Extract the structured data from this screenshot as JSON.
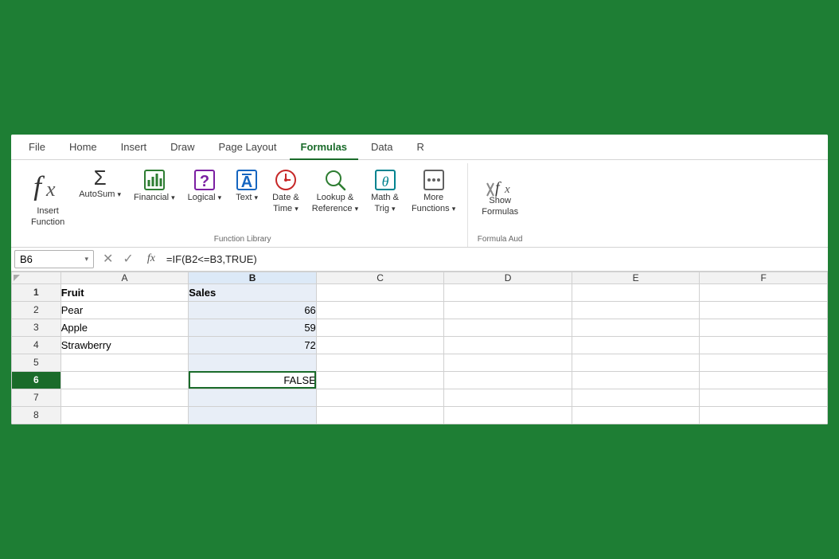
{
  "ribbon": {
    "tabs": [
      "File",
      "Home",
      "Insert",
      "Draw",
      "Page Layout",
      "Formulas",
      "Data",
      "R"
    ],
    "active_tab": "Formulas",
    "groups": [
      {
        "name": "function-library",
        "label": "Function Library",
        "buttons": [
          {
            "id": "insert-function",
            "icon": "fx",
            "label": "Insert\nFunction",
            "icon_type": "italic"
          },
          {
            "id": "autosum",
            "icon": "Σ",
            "label": "AutoSum",
            "has_chevron": true,
            "icon_type": "sigma"
          },
          {
            "id": "financial",
            "icon": "🏦",
            "label": "Financial",
            "has_chevron": true,
            "icon_type": "financial"
          },
          {
            "id": "logical",
            "icon": "?",
            "label": "Logical",
            "has_chevron": true,
            "icon_type": "logical"
          },
          {
            "id": "text",
            "icon": "A",
            "label": "Text",
            "has_chevron": true,
            "icon_type": "text"
          },
          {
            "id": "datetime",
            "icon": "⏰",
            "label": "Date &\nTime",
            "has_chevron": true,
            "icon_type": "datetime"
          },
          {
            "id": "lookup",
            "icon": "🔍",
            "label": "Lookup &\nReference",
            "has_chevron": true,
            "icon_type": "lookup"
          },
          {
            "id": "math",
            "icon": "θ",
            "label": "Math &\nTrig",
            "has_chevron": true,
            "icon_type": "math"
          },
          {
            "id": "more",
            "icon": "···",
            "label": "More\nFunctions",
            "has_chevron": true,
            "icon_type": "more"
          }
        ]
      },
      {
        "name": "formula-auditing",
        "label": "Formula Aud",
        "buttons": [
          {
            "id": "show-formulas",
            "icon": "fx",
            "label": "Show\nFormulas",
            "icon_type": "show-formula"
          }
        ]
      }
    ]
  },
  "formula_bar": {
    "cell_ref": "B6",
    "formula": "=IF(B2<=B3,TRUE)",
    "fx_label": "fx",
    "cancel_label": "✕",
    "confirm_label": "✓"
  },
  "spreadsheet": {
    "col_headers": [
      "",
      "A",
      "B",
      "C",
      "D",
      "E",
      "F"
    ],
    "active_col": "B",
    "active_row": 6,
    "rows": [
      {
        "num": "1",
        "a": "Fruit",
        "b": "Sales",
        "c": "",
        "d": "",
        "e": "",
        "f": "",
        "header": true
      },
      {
        "num": "2",
        "a": "Pear",
        "b": "66",
        "c": "",
        "d": "",
        "e": "",
        "f": ""
      },
      {
        "num": "3",
        "a": "Apple",
        "b": "59",
        "c": "",
        "d": "",
        "e": "",
        "f": ""
      },
      {
        "num": "4",
        "a": "Strawberry",
        "b": "72",
        "c": "",
        "d": "",
        "e": "",
        "f": ""
      },
      {
        "num": "5",
        "a": "",
        "b": "",
        "c": "",
        "d": "",
        "e": "",
        "f": ""
      },
      {
        "num": "6",
        "a": "",
        "b": "FALSE",
        "c": "",
        "d": "",
        "e": "",
        "f": "",
        "active": true
      },
      {
        "num": "7",
        "a": "",
        "b": "",
        "c": "",
        "d": "",
        "e": "",
        "f": ""
      },
      {
        "num": "8",
        "a": "",
        "b": "",
        "c": "",
        "d": "",
        "e": "",
        "f": ""
      }
    ]
  },
  "colors": {
    "accent": "#1a6b2a",
    "selected_col_bg": "#dce9f7",
    "cell_b_bg": "#e8eef7"
  }
}
